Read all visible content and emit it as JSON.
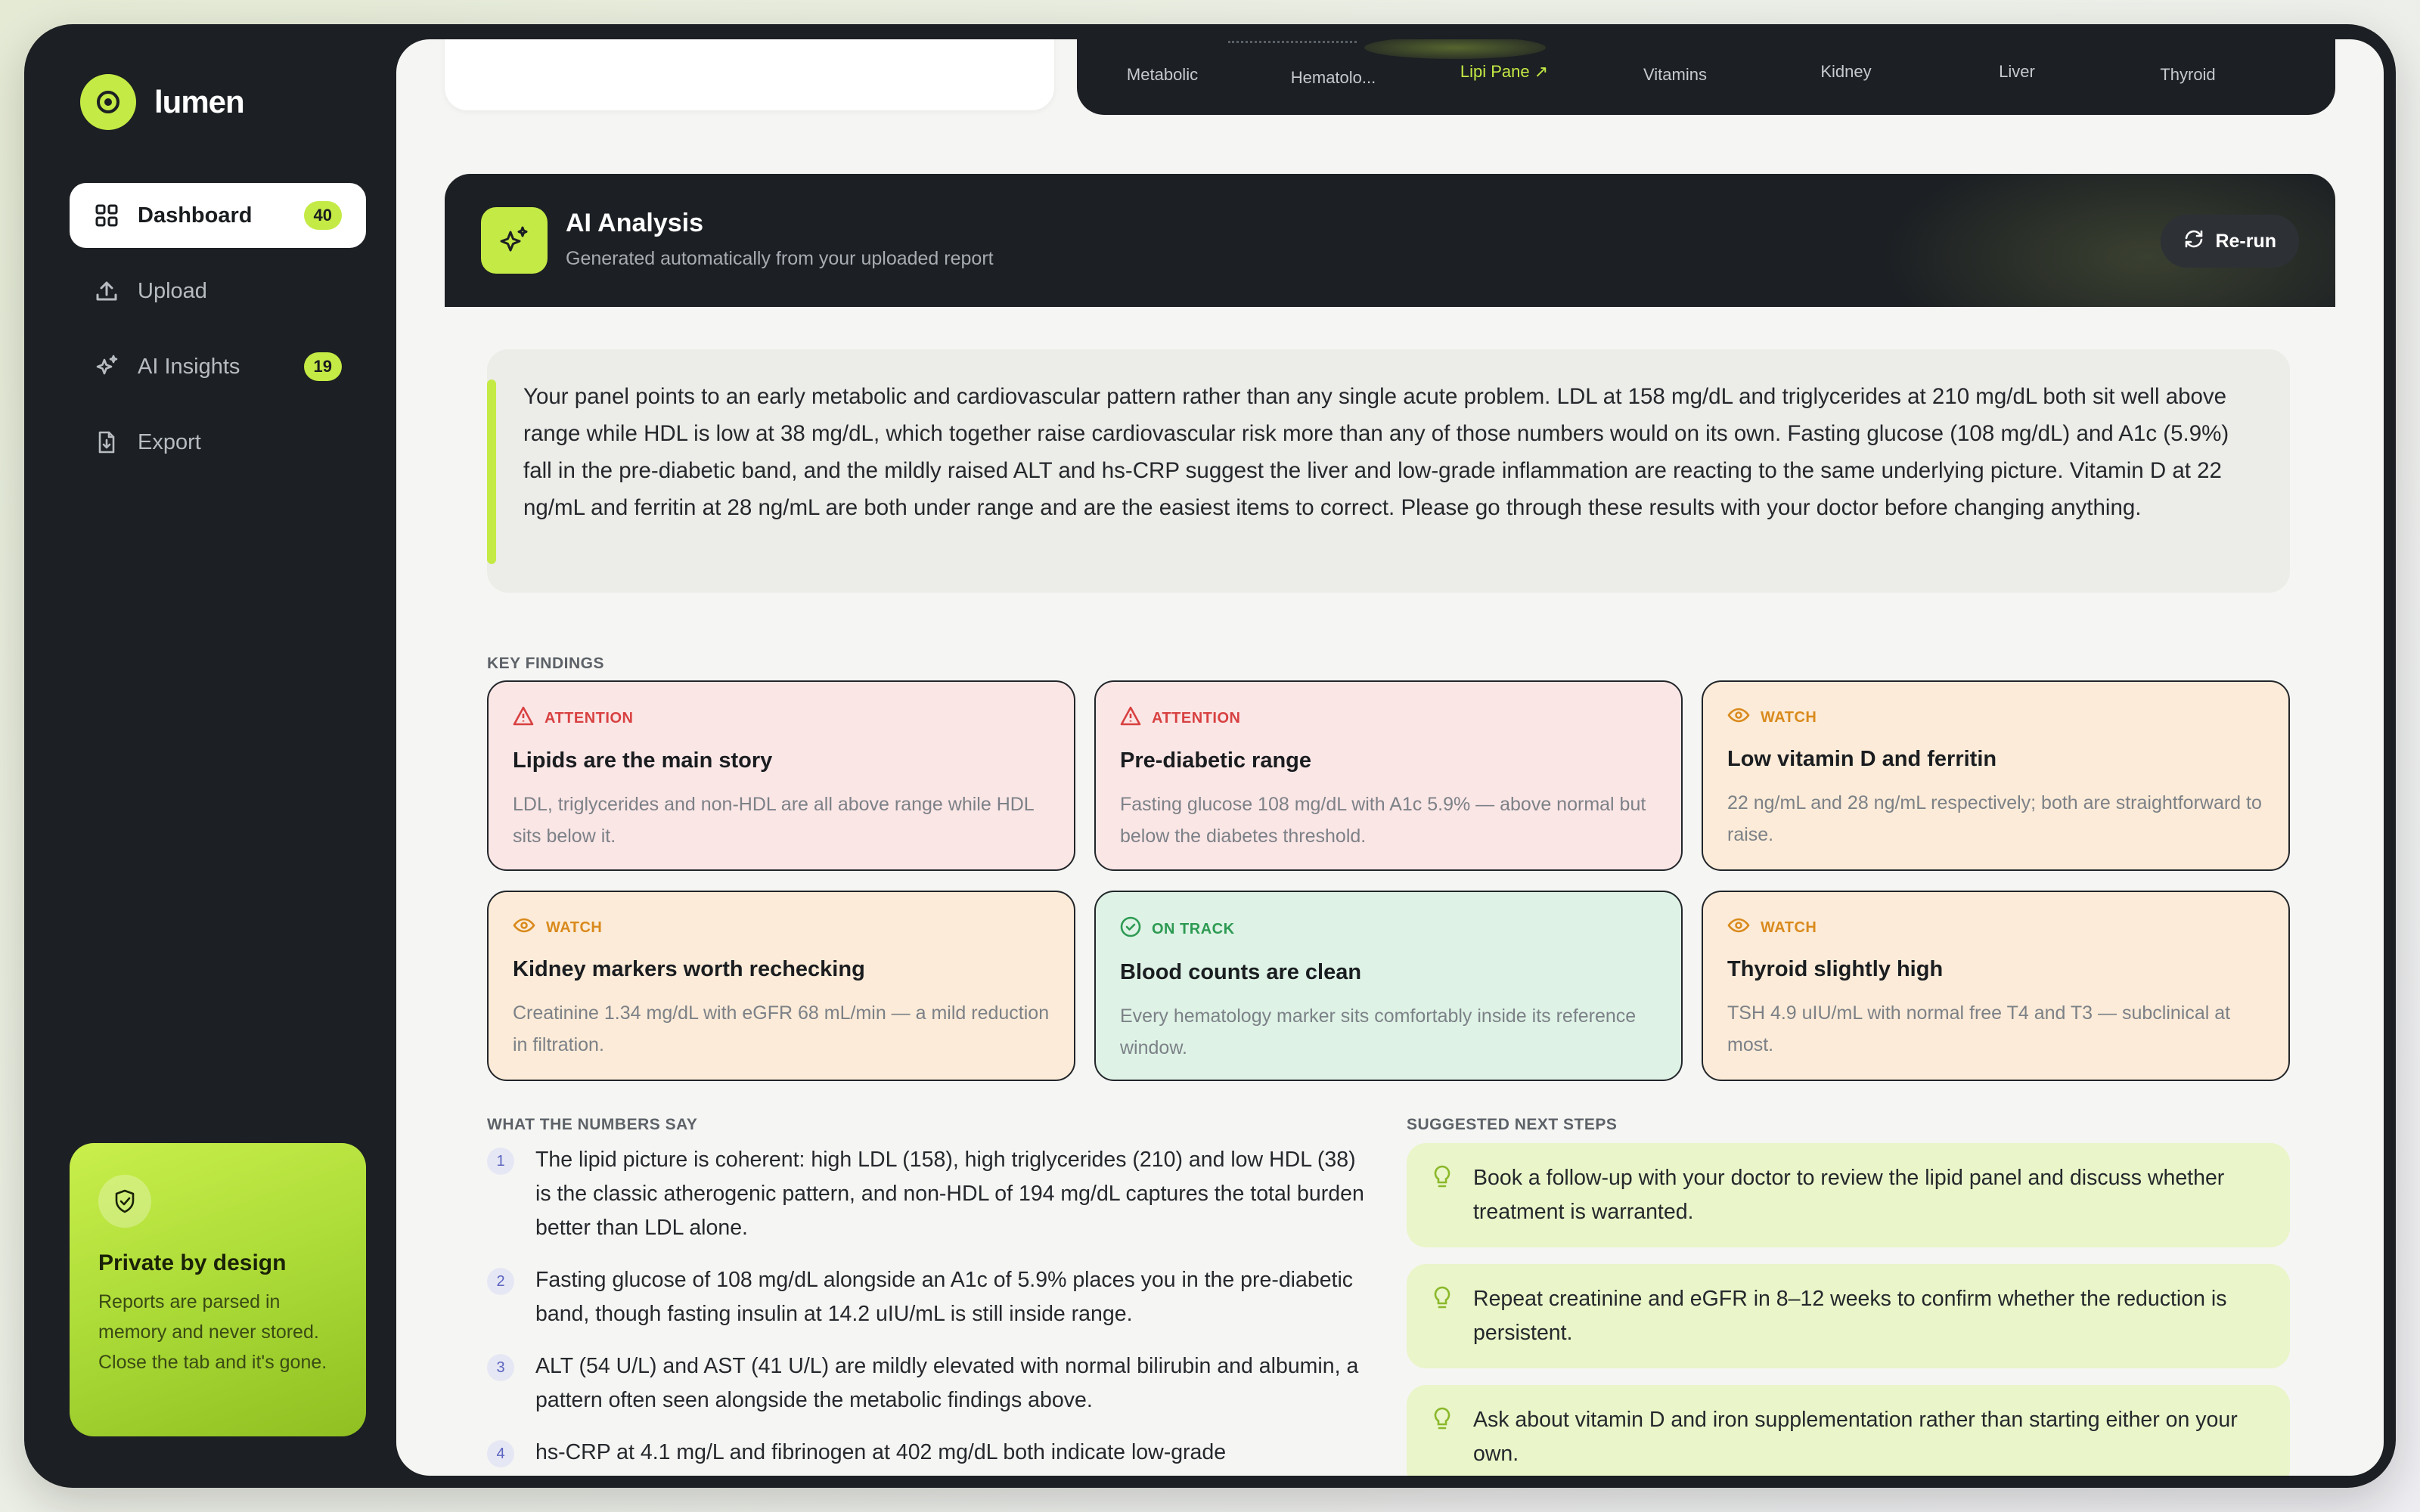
{
  "app": {
    "name": "lumen"
  },
  "sidebar": {
    "items": [
      {
        "label": "Dashboard",
        "badge": "40",
        "icon": "grid-icon",
        "active": true
      },
      {
        "label": "Upload",
        "badge": null,
        "icon": "upload-icon"
      },
      {
        "label": "AI Insights",
        "badge": "19",
        "icon": "sparkle-icon"
      },
      {
        "label": "Export",
        "badge": null,
        "icon": "file-export-icon"
      }
    ],
    "private_card": {
      "title": "Private by design",
      "text": "Reports are parsed in memory and never stored. Close the tab and it's gone."
    }
  },
  "tabs": [
    {
      "label": "Metabolic"
    },
    {
      "label": "Hematolo..."
    },
    {
      "label": "Lipi Pane ↗",
      "active": true
    },
    {
      "label": "Vitamins"
    },
    {
      "label": "Kidney"
    },
    {
      "label": "Liver"
    },
    {
      "label": "Thyroid"
    }
  ],
  "analysis": {
    "title": "AI Analysis",
    "subtitle": "Generated automatically from your uploaded report",
    "rerun_label": "Re-run",
    "summary": "Your panel points to an early metabolic and cardiovascular pattern rather than any single acute problem. LDL at 158 mg/dL and triglycerides at 210 mg/dL both sit well above range while HDL is low at 38 mg/dL, which together raise cardiovascular risk more than any of those numbers would on its own. Fasting glucose (108 mg/dL) and A1c (5.9%) fall in the pre-diabetic band, and the mildly raised ALT and hs-CRP suggest the liver and low-grade inflammation are reacting to the same underlying picture. Vitamin D at 22 ng/mL and ferritin at 28 ng/mL are both under range and are the easiest items to correct. Please go through these results with your doctor before changing anything."
  },
  "key_findings": {
    "label": "KEY FINDINGS",
    "cards": [
      {
        "status": "ATTENTION",
        "title": "Lipids are the main story",
        "text": "LDL, triglycerides and non-HDL are all above range while HDL sits below it."
      },
      {
        "status": "ATTENTION",
        "title": "Pre-diabetic range",
        "text": "Fasting glucose 108 mg/dL with A1c 5.9% — above normal but below the diabetes threshold."
      },
      {
        "status": "WATCH",
        "title": "Low vitamin D and ferritin",
        "text": "22 ng/mL and 28 ng/mL respectively; both are straightforward to raise."
      },
      {
        "status": "WATCH",
        "title": "Kidney markers worth rechecking",
        "text": "Creatinine 1.34 mg/dL with eGFR 68 mL/min — a mild reduction in filtration."
      },
      {
        "status": "ON TRACK",
        "title": "Blood counts are clean",
        "text": "Every hematology marker sits comfortably inside its reference window."
      },
      {
        "status": "WATCH",
        "title": "Thyroid slightly high",
        "text": "TSH 4.9 uIU/mL with normal free T4 and T3 — subclinical at most."
      }
    ]
  },
  "numbers_say": {
    "label": "WHAT THE NUMBERS SAY",
    "items": [
      {
        "idx": "1",
        "text": "The lipid picture is coherent: high LDL (158), high triglycerides (210) and low HDL (38) is the classic atherogenic pattern, and non-HDL of 194 mg/dL captures the total burden better than LDL alone."
      },
      {
        "idx": "2",
        "text": "Fasting glucose of 108 mg/dL alongside an A1c of 5.9% places you in the pre-diabetic band, though fasting insulin at 14.2 uIU/mL is still inside range."
      },
      {
        "idx": "3",
        "text": "ALT (54 U/L) and AST (41 U/L) are mildly elevated with normal bilirubin and albumin, a pattern often seen alongside the metabolic findings above."
      },
      {
        "idx": "4",
        "text": "hs-CRP at 4.1 mg/L and fibrinogen at 402 mg/dL both indicate low-grade"
      }
    ]
  },
  "next_steps": {
    "label": "SUGGESTED NEXT STEPS",
    "items": [
      {
        "text": "Book a follow-up with your doctor to review the lipid panel and discuss whether treatment is warranted."
      },
      {
        "text": "Repeat creatinine and eGFR in 8–12 weeks to confirm whether the reduction is persistent."
      },
      {
        "text": "Ask about vitamin D and iron supplementation rather than starting either on your own."
      }
    ]
  },
  "colors": {
    "accent": "#c4ea45",
    "attention": "#d84141",
    "watch": "#d98a1d",
    "on_track": "#2d9a52",
    "sidebar_bg": "#1c1f23"
  }
}
